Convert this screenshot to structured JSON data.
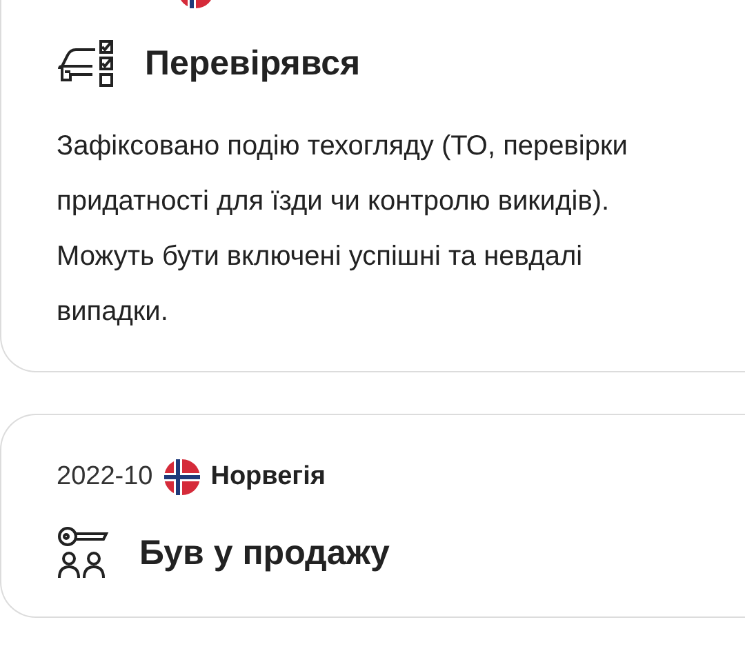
{
  "events": [
    {
      "kind": "inspection",
      "title": "Перевірявся",
      "description": "Зафіксовано подію техогляду (ТО, перевірки придатності для їзди чи контролю викидів). Можуть бути включені успішні та невдалі випадки."
    },
    {
      "kind": "sale",
      "date": "2022-10",
      "country": "Норвегія",
      "title": "Був у продажу"
    }
  ]
}
